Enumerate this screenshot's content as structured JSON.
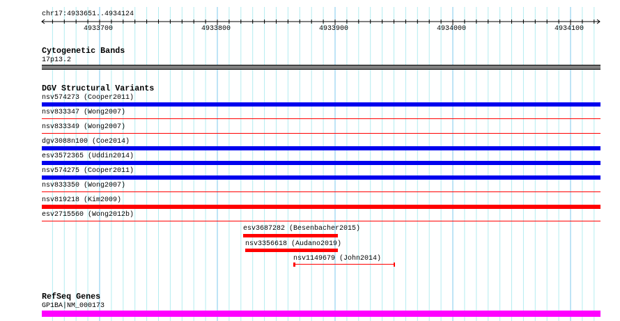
{
  "ruler": {
    "region": "chr17:4933651..4934124",
    "start": 4933651,
    "end": 4934124,
    "tick_labels": [
      "4933700",
      "4933800",
      "4933900",
      "4934000",
      "4934100"
    ]
  },
  "tracks": {
    "cytoband": {
      "title": "Cytogenetic Bands",
      "label": "17p13.2",
      "color": "#808080"
    },
    "dgv": {
      "title": "DGV Structural Variants",
      "rows": [
        {
          "label": "nsv574273 (Cooper2011)",
          "color": "#0000ee",
          "style": "thick"
        },
        {
          "label": "nsv833347 (Wong2007)",
          "color": "#ff0000",
          "style": "thin"
        },
        {
          "label": "nsv833349 (Wong2007)",
          "color": "#ff0000",
          "style": "thin"
        },
        {
          "label": "dgv3088n100 (Coe2014)",
          "color": "#0000ee",
          "style": "thick"
        },
        {
          "label": "esv3572365 (Uddin2014)",
          "color": "#0000ee",
          "style": "thick"
        },
        {
          "label": "nsv574275 (Cooper2011)",
          "color": "#0000ee",
          "style": "thick"
        },
        {
          "label": "nsv833350 (Wong2007)",
          "color": "#ff0000",
          "style": "thin"
        },
        {
          "label": "nsv819218 (Kim2009)",
          "color": "#ff0000",
          "style": "thick"
        },
        {
          "label": "esv2715560 (Wong2012b)",
          "color": "#ff0000",
          "style": "thin"
        }
      ],
      "partial": [
        {
          "label": "esv3687282 (Besenbacher2015)",
          "color": "#ff0000"
        },
        {
          "label": "nsv3356618 (Audano2019)",
          "color": "#ff0000"
        },
        {
          "label": "nsv1149679 (John2014)",
          "color": "#ff0000"
        }
      ]
    },
    "refseq": {
      "title": "RefSeq Genes",
      "label": "GP1BA|NM_000173",
      "color": "#ff00ff"
    }
  }
}
